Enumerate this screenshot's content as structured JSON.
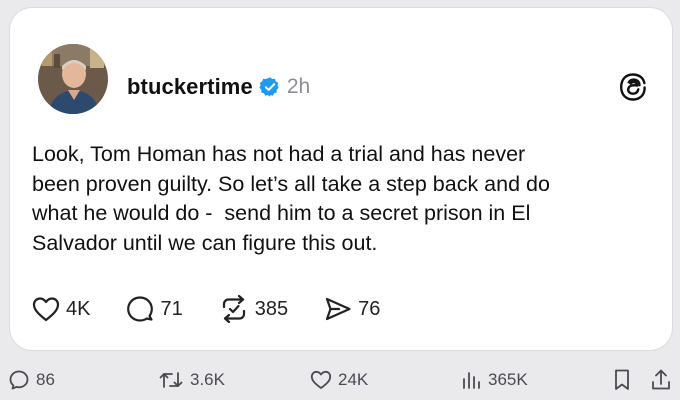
{
  "post": {
    "username": "btuckertime",
    "timestamp": "2h",
    "text": "Look, Tom Homan has not had a trial and has never\nbeen proven guilty. So let’s all take a step back and do\nwhat he would do -  send him to a secret prison in El\nSalvador until we can figure this out.",
    "likes": "4K",
    "replies": "71",
    "reposts": "385",
    "shares": "76"
  },
  "bottom_bar": {
    "replies": "86",
    "retweets": "3.6K",
    "likes": "24K",
    "views": "365K"
  },
  "icons": {
    "verified": "verified-badge-icon",
    "platform": "threads-logo-icon",
    "like": "heart-icon",
    "reply": "speech-bubble-icon",
    "repost": "repost-icon",
    "share": "send-icon",
    "bookmark": "bookmark-icon",
    "upload": "share-upload-icon",
    "views": "bar-chart-icon"
  },
  "colors": {
    "verified_blue": "#1d9bf0",
    "text": "#111111",
    "muted": "#8e8e93"
  }
}
